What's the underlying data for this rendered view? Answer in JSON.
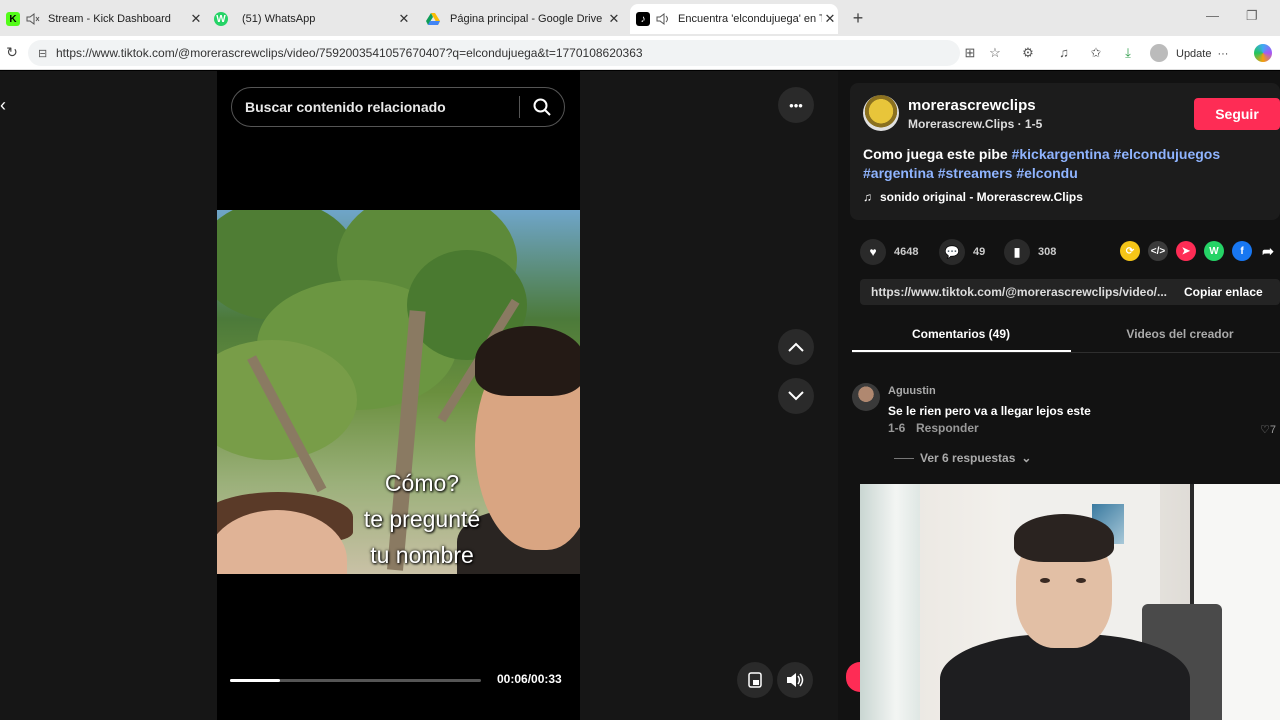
{
  "browser": {
    "tabs": [
      {
        "title": "Stream - Kick Dashboard",
        "favicon_color": "#53fc18",
        "favicon_glyph": "K"
      },
      {
        "title": "(51) WhatsApp",
        "favicon_color": "#25d366",
        "favicon_glyph": "W"
      },
      {
        "title": "Página principal - Google Drive",
        "favicon_color": "#4285f4",
        "favicon_glyph": "D"
      },
      {
        "title": "Encuentra 'elcondujuega' en T",
        "favicon_color": "#000000",
        "favicon_glyph": "♪"
      }
    ],
    "new_tab": "+",
    "url": "https://www.tiktok.com/@morerascrewclips/video/7592003541057670407?q=elcondujuega&t=1770108620363",
    "update_label": "Update",
    "more_label": "···"
  },
  "player": {
    "search_placeholder": "Buscar contenido relacionado",
    "caption_lines": [
      "Cómo?",
      "te pregunté",
      "tu nombre"
    ],
    "time": "00:06/00:33",
    "progress_fraction": 0.2,
    "more_icon": "•••"
  },
  "post": {
    "username": "morerascrewclips",
    "subtitle": "Morerascrew.Clips · 1-5",
    "follow_label": "Seguir",
    "description_text": "Como juega este pibe ",
    "hashtags": [
      "#kickargentina",
      "#elcondujuegos",
      "#argentina",
      "#streamers",
      "#elcondu"
    ],
    "music": "sonido original - Morerascrew.Clips",
    "likes": "4648",
    "comments": "49",
    "saves": "308",
    "link": "https://www.tiktok.com/@morerascrewclips/video/...",
    "copy_label": "Copiar enlace",
    "share_colors": [
      "#f5c518",
      "#3a3a3a",
      "#fe2c55",
      "#25d366",
      "#1877f2"
    ]
  },
  "tabs": {
    "comments": "Comentarios (49)",
    "creator_videos": "Videos del creador"
  },
  "comment": {
    "user": "Aguustin",
    "text": "Se le rien pero va a llegar lejos este",
    "date": "1-6",
    "reply": "Responder",
    "like_count": "7",
    "view_replies": "Ver 6 respuestas"
  }
}
